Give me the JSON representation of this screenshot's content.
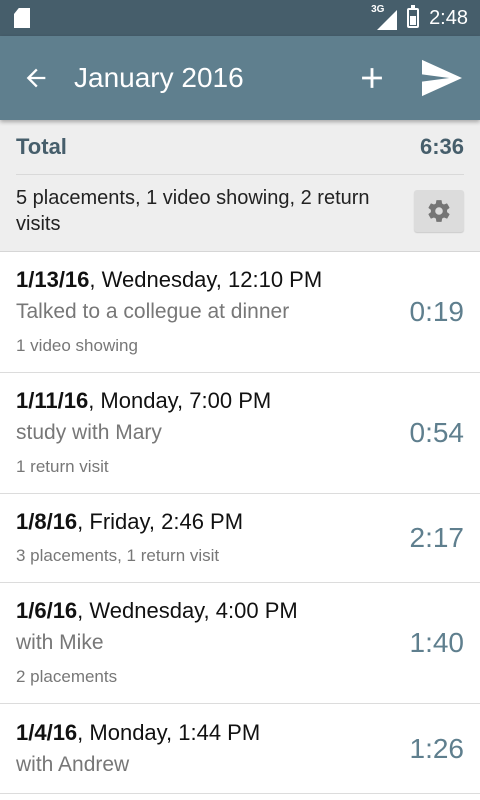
{
  "status_bar": {
    "network": "3G",
    "time": "2:48"
  },
  "toolbar": {
    "title": "January 2016",
    "back_icon": "arrow-left-icon",
    "add_icon": "plus-icon",
    "send_icon": "send-icon"
  },
  "summary": {
    "total_label": "Total",
    "total_value": "6:36",
    "description": "5 placements, 1 video showing, 2 return visits",
    "settings_icon": "gear-icon"
  },
  "entries": [
    {
      "date": "1/13/16",
      "rest": ", Wednesday, 12:10 PM",
      "note": "Talked to a collegue at dinner",
      "sub": "1 video showing",
      "duration": "0:19"
    },
    {
      "date": "1/11/16",
      "rest": ", Monday, 7:00 PM",
      "note": "study with Mary",
      "sub": "1 return visit",
      "duration": "0:54"
    },
    {
      "date": "1/8/16",
      "rest": ", Friday, 2:46 PM",
      "note": "",
      "sub": "3 placements, 1 return visit",
      "duration": "2:17"
    },
    {
      "date": "1/6/16",
      "rest": ", Wednesday, 4:00 PM",
      "note": "with Mike",
      "sub": "2 placements",
      "duration": "1:40"
    },
    {
      "date": "1/4/16",
      "rest": ", Monday, 1:44 PM",
      "note": "with Andrew",
      "sub": "",
      "duration": "1:26"
    }
  ],
  "colors": {
    "statusbar": "#465e6b",
    "toolbar": "#5f7f8e",
    "accent": "#5f7f8e"
  }
}
